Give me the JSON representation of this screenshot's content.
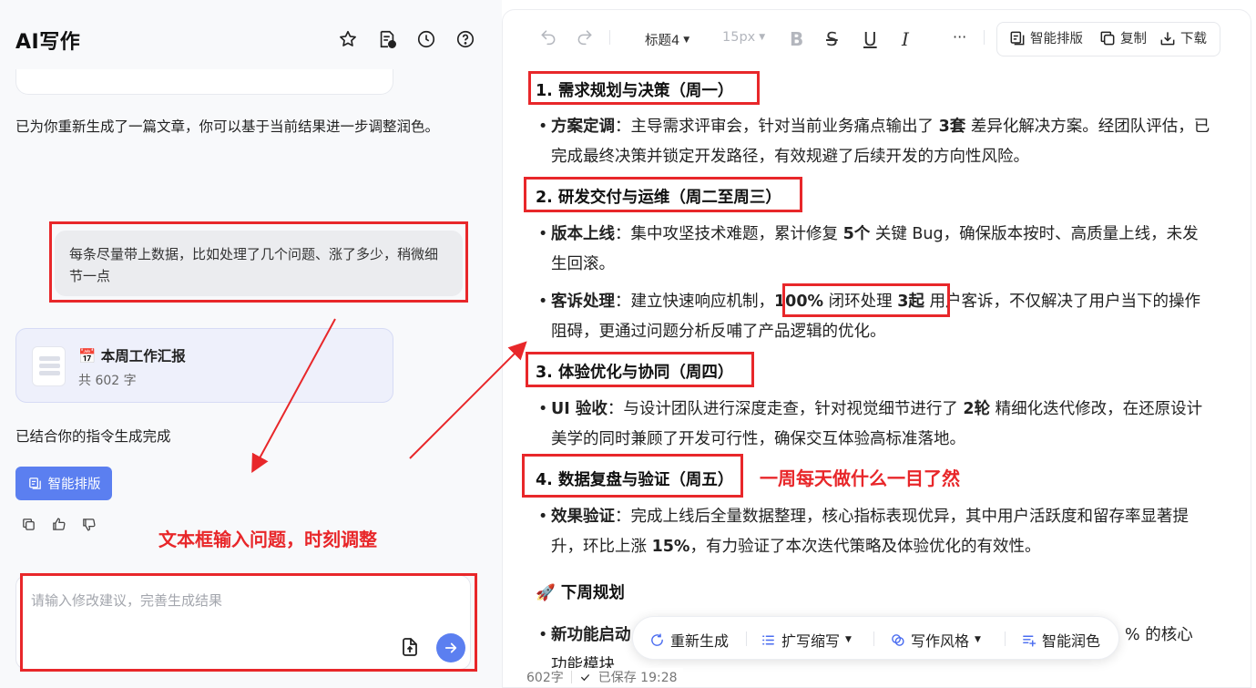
{
  "app": {
    "title": "AI写作"
  },
  "chat": {
    "ai_message_1": "已为你重新生成了一篇文章，你可以基于当前结果进一步调整润色。",
    "user_message": "每条尽量带上数据，比如处理了几个问题、涨了多少，稍微细节一点",
    "doc_card": {
      "emoji": "📅",
      "title": "本周工作汇报",
      "count": "共 602 字"
    },
    "ai_message_2": "已结合你的指令生成完成",
    "smart_layout_button": "智能排版",
    "input_placeholder": "请输入修改建议，完善生成结果"
  },
  "annotations": {
    "left_note": "文本框输入问题，时刻调整",
    "right_note": "一周每天做什么一目了然",
    "accent_color": "#e8272a"
  },
  "toolbar": {
    "heading_select": "标题4",
    "font_size_select": "15px",
    "more": "···",
    "smart_layout": "智能排版",
    "copy": "复制",
    "download": "下载"
  },
  "document": {
    "sec1_title": "1. 需求规划与决策（周一）",
    "sec1_item1": {
      "label": "方案定调",
      "p1": "：主导需求评审会，针对当前业务痛点输出了 ",
      "b1": "3套",
      "p2": " 差异化解决方案。经团队评估，已完成最终决策并锁定开发路径，有效规避了后续开发的方向性风险。"
    },
    "sec2_title": "2. 研发交付与运维（周二至周三）",
    "sec2_item1": {
      "label": "版本上线",
      "p1": "：集中攻坚技术难题，累计修复 ",
      "b1": "5个",
      "p2": " 关键 Bug，确保版本按时、高质量上线，未发生回滚。"
    },
    "sec2_item2": {
      "label": "客诉处理",
      "p1": "：建立快速响应机制，",
      "b1": "100%",
      "p2": " 闭环处理 ",
      "b2": "3起",
      "p3": " 用户客诉，不仅解决了用户当下的操作阻碍，更通过问题分析反哺了产品逻辑的优化。"
    },
    "sec3_title": "3. 体验优化与协同（周四）",
    "sec3_item1": {
      "label": "UI 验收",
      "p1": "：与设计团队进行深度走查，针对视觉细节进行了 ",
      "b1": "2轮",
      "p2": " 精细化迭代修改，在还原设计美学的同时兼顾了开发可行性，确保交互体验高标准落地。"
    },
    "sec4_title": "4. 数据复盘与验证（周五）",
    "sec4_item1": {
      "label": "效果验证",
      "p1": "：完成上线后全量数据整理，核心指标表现优异，其中用户活跃度和留存率显著提升，环比上涨 ",
      "b1": "15%",
      "p2": "，有力验证了本次迭代策略及体验优化的有效性。"
    },
    "next_week_title": "🚀 下周规划",
    "next_item1": {
      "label": "新功能启动",
      "tail": "% 的核心",
      "line2": "功能模块"
    }
  },
  "float_bar": {
    "regenerate": "重新生成",
    "expand": "扩写缩写",
    "style": "写作风格",
    "polish": "智能润色"
  },
  "status_bar": {
    "word_count": "602字",
    "saved": "已保存 19:28"
  }
}
